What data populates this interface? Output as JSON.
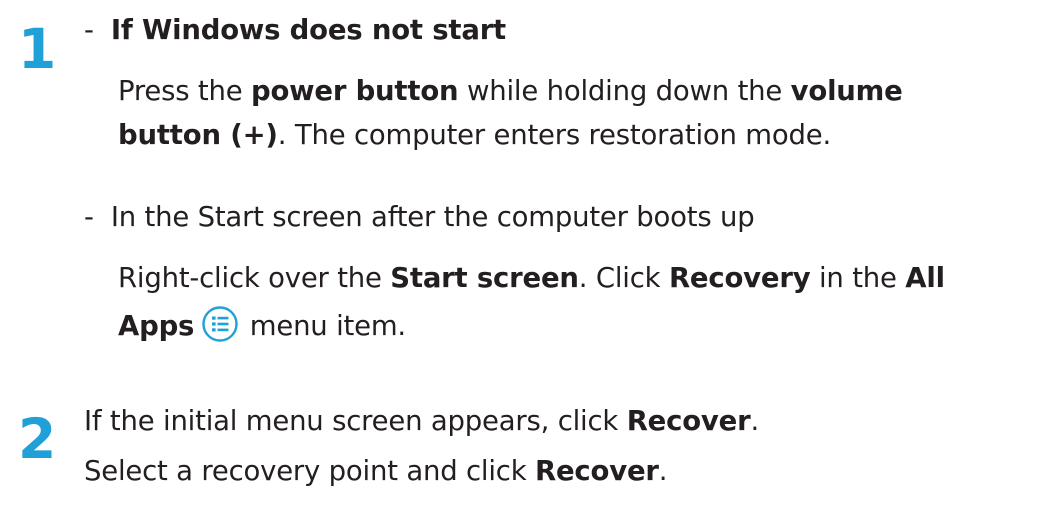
{
  "step1": {
    "number": "1",
    "bullet_a": {
      "dash": "-",
      "heading": "If Windows does not start"
    },
    "para_a1": {
      "t1": "Press the ",
      "b1": "power button",
      "t2": " while holding down the ",
      "b2": "volume"
    },
    "para_a2": {
      "b1": "button (+)",
      "t1": ". The computer enters restoration mode."
    },
    "bullet_b": {
      "dash": "-",
      "heading": "In the Start screen after the computer boots up"
    },
    "para_b1": {
      "t1": "Right-click over the ",
      "b1": "Start screen",
      "t2": ". Click ",
      "b2": "Recovery",
      "t3": " in the ",
      "b3": "All"
    },
    "para_b2": {
      "b1": "Apps",
      "icon": "all-apps-icon",
      "t1": " menu item."
    }
  },
  "step2": {
    "number": "2",
    "line1": {
      "t1": "If the initial menu screen appears, click ",
      "b1": "Recover",
      "t2": "."
    },
    "line2": {
      "t1": "Select a recovery point and click ",
      "b1": "Recover",
      "t2": "."
    }
  },
  "colors": {
    "accent": "#1fa0d6",
    "text": "#231f20"
  }
}
